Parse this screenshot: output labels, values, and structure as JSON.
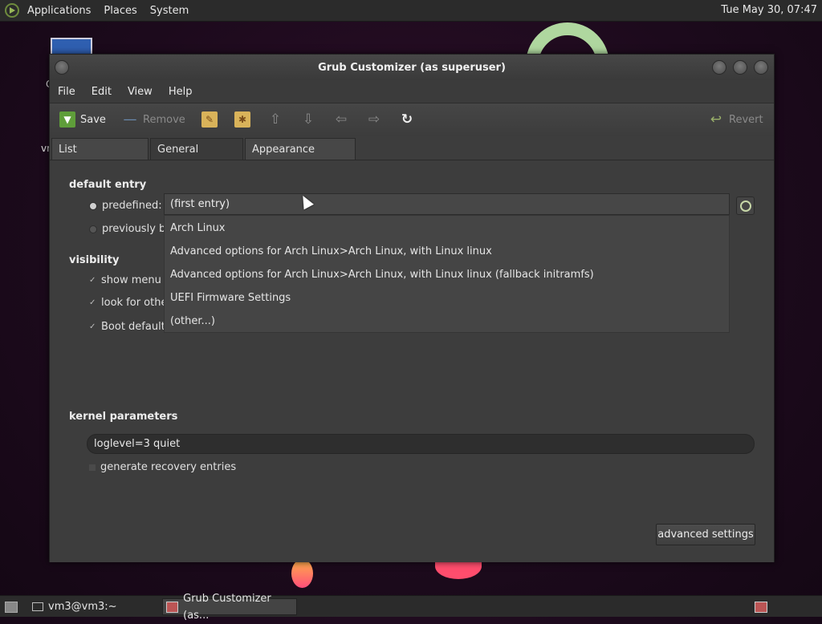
{
  "top_panel": {
    "menus": [
      "Applications",
      "Places",
      "System"
    ],
    "clock": "Tue May 30, 07:47"
  },
  "desktop": {
    "label_partial": "vr",
    "label_partial2": "C"
  },
  "window": {
    "title": "Grub Customizer (as superuser)",
    "menubar": [
      "File",
      "Edit",
      "View",
      "Help"
    ],
    "toolbar": {
      "save": "Save",
      "remove": "Remove",
      "revert": "Revert"
    },
    "tabs": [
      "List configuration",
      "General settings",
      "Appearance settings"
    ],
    "active_tab": "General settings",
    "general": {
      "default_entry_title": "default entry",
      "predefined_label": "predefined:",
      "previously_label": "previously bo",
      "combo_value": "(first entry)",
      "dropdown_items": [
        "Arch Linux",
        "Advanced options for Arch Linux>Arch Linux, with Linux linux",
        "Advanced options for Arch Linux>Arch Linux, with Linux linux (fallback initramfs)",
        "UEFI Firmware Settings",
        "(other...)"
      ],
      "visibility_title": "visibility",
      "show_menu": "show menu",
      "look_for_other": "look for othe",
      "boot_default": "Boot default",
      "kernel_title": "kernel parameters",
      "kernel_value": "loglevel=3 quiet",
      "generate_recovery": "generate recovery entries",
      "advanced_button": "advanced settings"
    }
  },
  "bottom_panel": {
    "tasks": [
      "vm3@vm3:~",
      "Grub Customizer (as..."
    ]
  }
}
